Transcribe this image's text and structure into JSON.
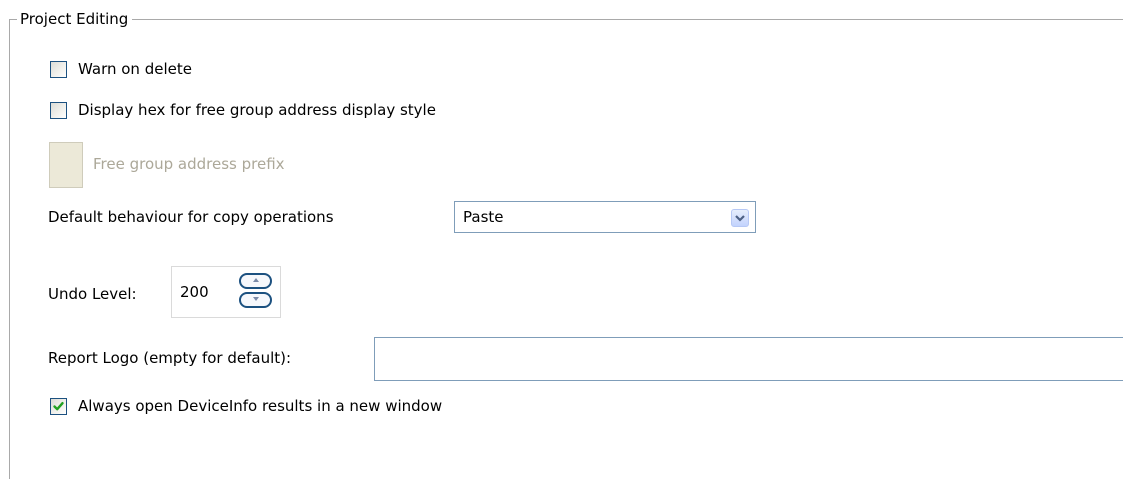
{
  "group": {
    "title": "Project Editing"
  },
  "options": {
    "warn_on_delete": {
      "label": "Warn on delete",
      "checked": false
    },
    "display_hex": {
      "label": "Display hex for free group address display style",
      "checked": false
    },
    "free_group_prefix": {
      "label": "Free group address prefix",
      "enabled": false
    },
    "copy_behaviour": {
      "label": "Default behaviour for copy operations",
      "selected": "Paste"
    },
    "undo_level": {
      "label": "Undo Level:",
      "value": "200"
    },
    "report_logo": {
      "label": "Report Logo (empty for default):",
      "value": ""
    },
    "open_deviceinfo": {
      "label": "Always open DeviceInfo results in a new window",
      "checked": true
    }
  },
  "colors": {
    "check_mark": "#21a121",
    "checkbox_border": "#1c5180",
    "disabled_text": "#aca899",
    "group_border": "#a9a9a9"
  },
  "icons": {
    "dropdown": "chevron-down-icon",
    "spin_up": "arrow-up-icon",
    "spin_down": "arrow-down-icon",
    "check": "check-icon"
  }
}
